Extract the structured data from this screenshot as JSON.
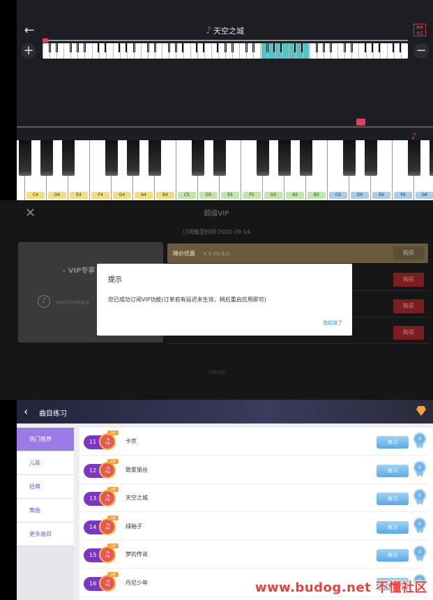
{
  "piano": {
    "back_icon": "arrow-left-icon",
    "song_title": "天空之城",
    "corner_tag": "美西 社区",
    "plus": "+",
    "minus": "−",
    "key_labels": [
      "C4",
      "D4",
      "E4",
      "F4",
      "G4",
      "A4",
      "B4",
      "C5",
      "D5",
      "E5",
      "F5",
      "G5",
      "A5",
      "B5",
      "C6",
      "D6",
      "E6",
      "F6",
      "G6"
    ],
    "label_colors": {
      "oct4": "#f4de7a",
      "oct5": "#bfe7a8",
      "oct6": "#a8cdf0"
    }
  },
  "vip": {
    "close": "✕",
    "title": "超级VIP",
    "expiry": "订阅截至时间:2020-09-14",
    "card_title": "- VIP专享 -",
    "card_desc": "解锁所有钢琴曲目",
    "promo_label": "降价优惠",
    "promo_price": "¥ 9.99/永久",
    "buy": "购买",
    "footer": "- 订阅说明 -",
    "dialog": {
      "title": "提示",
      "message": "您已成功订阅VIP功能(订单若有延迟未生效，稍后重启应用即可)",
      "ok": "我知道了"
    }
  },
  "practice": {
    "title": "曲目练习",
    "sidebar": [
      "热门推荐",
      "儿歌",
      "经典",
      "舞曲",
      "更多曲目"
    ],
    "songs": [
      {
        "num": "11",
        "name": "卡农"
      },
      {
        "num": "12",
        "name": "致爱丽丝"
      },
      {
        "num": "13",
        "name": "天空之城"
      },
      {
        "num": "14",
        "name": "绿袖子"
      },
      {
        "num": "15",
        "name": "梦的传说"
      },
      {
        "num": "16",
        "name": "丹尼少年"
      }
    ],
    "vip_tag": "VIP",
    "practice_label": "练习",
    "score": "0"
  },
  "watermark": "www.budog.net 不懂社区",
  "colors": {
    "accent": "#e0405a",
    "purple": "#7b36c8",
    "blue": "#5aa9e6"
  }
}
